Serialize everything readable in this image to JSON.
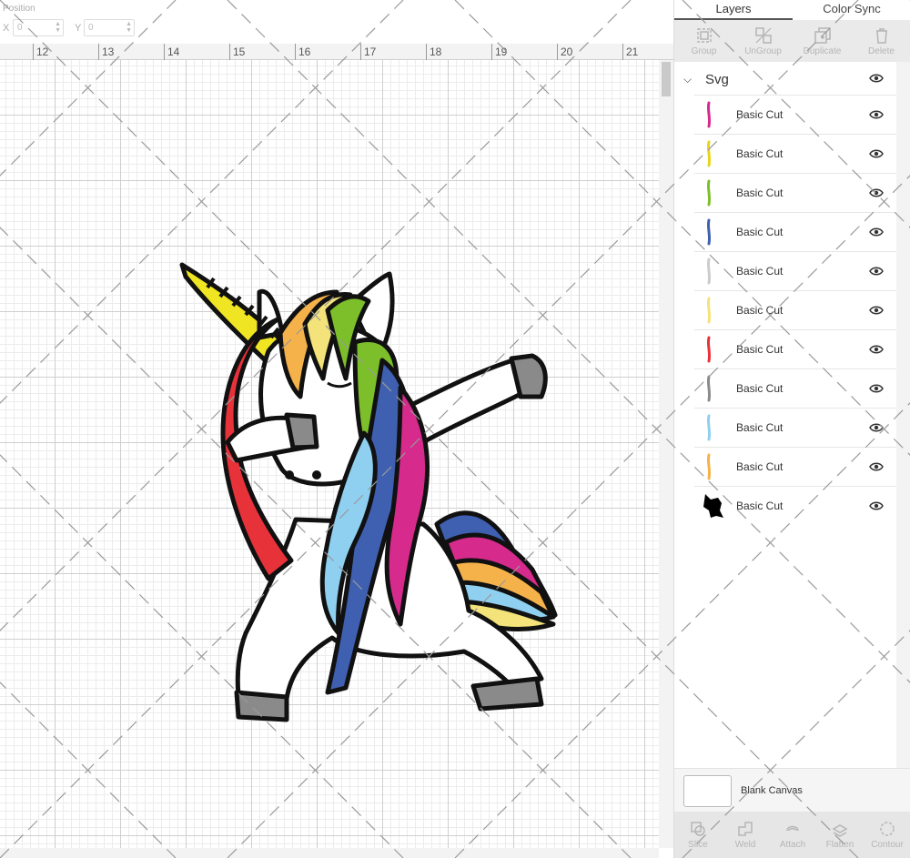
{
  "position": {
    "title": "Position",
    "x_label": "X",
    "x_value": "0",
    "y_label": "Y",
    "y_value": "0"
  },
  "ruler": {
    "ticks": [
      "12",
      "13",
      "14",
      "15",
      "16",
      "17",
      "18",
      "19",
      "20",
      "21"
    ]
  },
  "panel": {
    "tabs": [
      {
        "label": "Layers",
        "active": true
      },
      {
        "label": "Color Sync",
        "active": false
      }
    ],
    "toolbar": [
      {
        "label": "Group",
        "icon": "group-icon"
      },
      {
        "label": "UnGroup",
        "icon": "ungroup-icon"
      },
      {
        "label": "Duplicate",
        "icon": "duplicate-icon"
      },
      {
        "label": "Delete",
        "icon": "delete-icon"
      }
    ],
    "group_name": "Svg",
    "layers": [
      {
        "name": "Basic Cut",
        "color": "#d62b8c"
      },
      {
        "name": "Basic Cut",
        "color": "#e8d51a"
      },
      {
        "name": "Basic Cut",
        "color": "#7cbf2a"
      },
      {
        "name": "Basic Cut",
        "color": "#3f5fb0"
      },
      {
        "name": "Basic Cut",
        "color": "#ffffff"
      },
      {
        "name": "Basic Cut",
        "color": "#f3e37a"
      },
      {
        "name": "Basic Cut",
        "color": "#e8323a"
      },
      {
        "name": "Basic Cut",
        "color": "#8a8a8a"
      },
      {
        "name": "Basic Cut",
        "color": "#8fd0f0"
      },
      {
        "name": "Basic Cut",
        "color": "#f5b24a"
      },
      {
        "name": "Basic Cut",
        "color": "#000000"
      }
    ],
    "blank_canvas_label": "Blank Canvas",
    "bottom_tools": [
      {
        "label": "Slice",
        "icon": "slice-icon"
      },
      {
        "label": "Weld",
        "icon": "weld-icon"
      },
      {
        "label": "Attach",
        "icon": "attach-icon"
      },
      {
        "label": "Flatten",
        "icon": "flatten-icon"
      },
      {
        "label": "Contour",
        "icon": "contour-icon"
      }
    ]
  }
}
